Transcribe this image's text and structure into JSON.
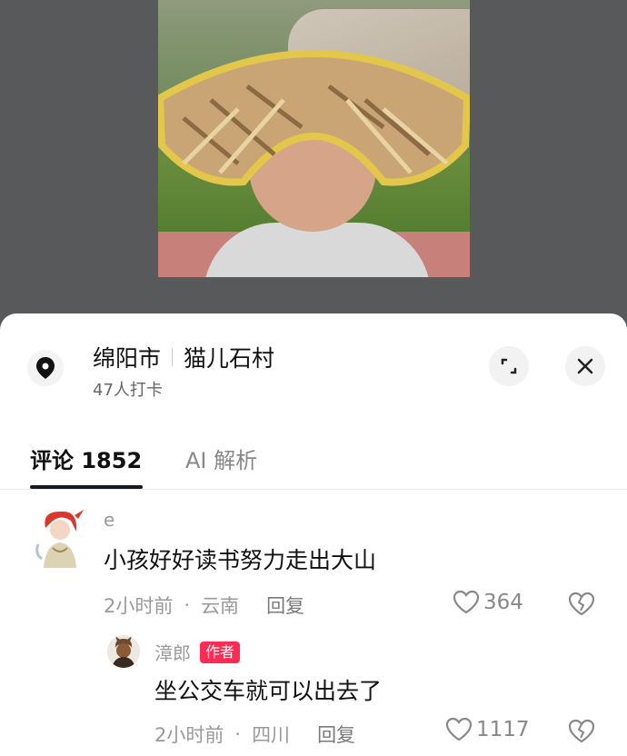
{
  "location": {
    "city": "绵阳市",
    "place": "猫儿石村",
    "checkins": "47人打卡"
  },
  "tabs": {
    "comments_label": "评论 1852",
    "ai_label": "AI 解析"
  },
  "comments": [
    {
      "user": "e",
      "text": "小孩好好读书努力走出大山",
      "time": "2小时前",
      "region": "云南",
      "reply_label": "回复",
      "likes": "364"
    },
    {
      "user": "漳郎",
      "badge": "作者",
      "text": "坐公交车就可以出去了",
      "time": "2小时前",
      "region": "四川",
      "reply_label": "回复",
      "likes": "1117"
    }
  ],
  "colors": {
    "accent": "#fe2c55",
    "backdrop": "#57585a"
  }
}
